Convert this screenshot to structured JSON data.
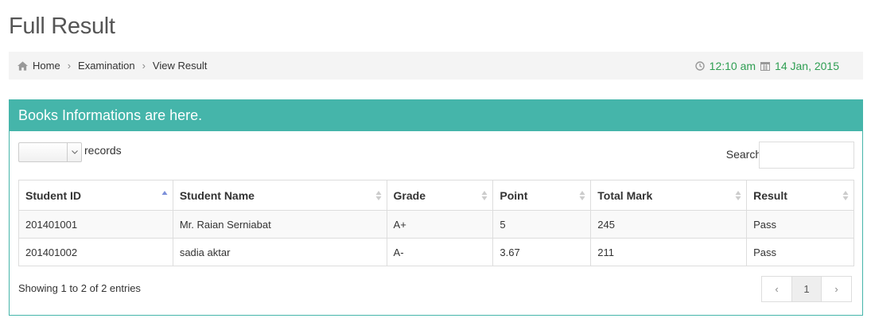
{
  "page": {
    "title": "Full Result"
  },
  "breadcrumb": {
    "items": [
      {
        "label": "Home",
        "icon": "home-icon"
      },
      {
        "label": "Examination"
      },
      {
        "label": "View Result"
      }
    ],
    "separator": "›"
  },
  "datetime": {
    "time": "12:10 am",
    "date": "14 Jan, 2015",
    "color": "#2e9e52"
  },
  "panel": {
    "heading": "Books Informations are here.",
    "accent": "#45b5aa",
    "length_select": {
      "value": "",
      "label": "records"
    },
    "search": {
      "label": "Search:",
      "value": ""
    },
    "table": {
      "columns": [
        "Student ID",
        "Student Name",
        "Grade",
        "Point",
        "Total Mark",
        "Result"
      ],
      "sorted_column": "Student ID",
      "rows": [
        [
          "201401001",
          "Mr. Raian Serniabat",
          "A+",
          "5",
          "245",
          "Pass"
        ],
        [
          "201401002",
          "sadia aktar",
          "A-",
          "3.67",
          "211",
          "Pass"
        ]
      ]
    },
    "info": "Showing 1 to 2 of 2 entries",
    "pagination": {
      "prev": "‹",
      "current": "1",
      "next": "›"
    }
  }
}
